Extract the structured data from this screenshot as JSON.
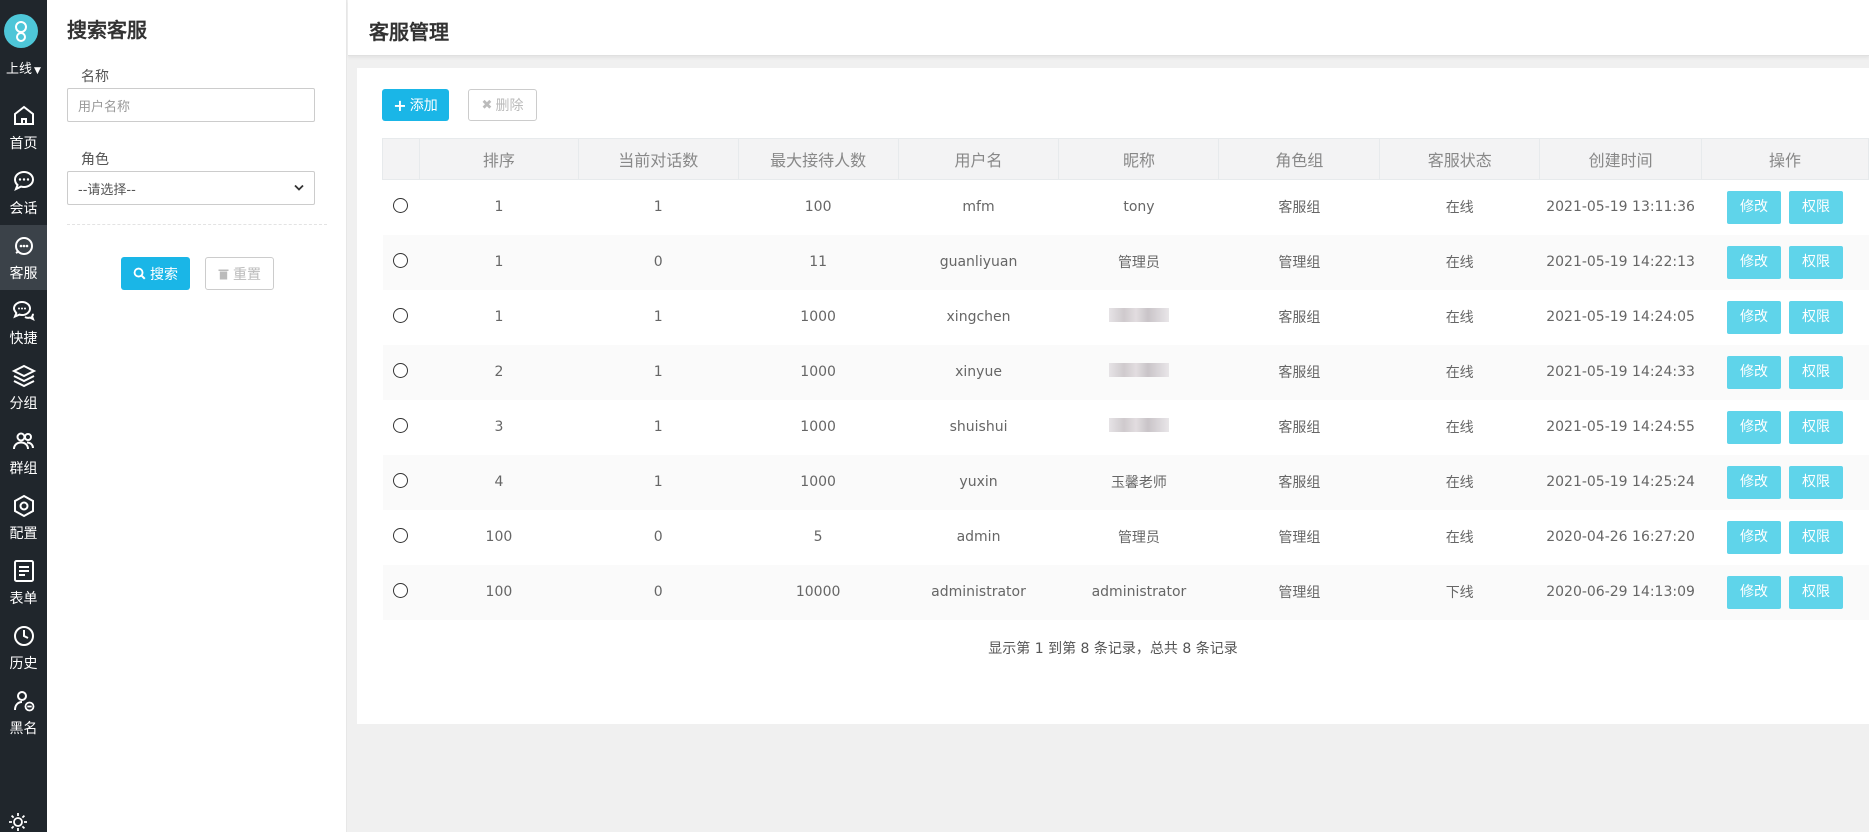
{
  "rail": {
    "status_label": "上线",
    "nav": [
      {
        "label": "首页",
        "icon": "home-icon"
      },
      {
        "label": "会话",
        "icon": "chat-icon"
      },
      {
        "label": "客服",
        "icon": "service-icon"
      },
      {
        "label": "快捷",
        "icon": "quick-reply-icon"
      },
      {
        "label": "分组",
        "icon": "layers-icon"
      },
      {
        "label": "群组",
        "icon": "group-icon"
      },
      {
        "label": "配置",
        "icon": "hexagon-gear-icon"
      },
      {
        "label": "表单",
        "icon": "form-icon"
      },
      {
        "label": "历史",
        "icon": "clock-icon"
      },
      {
        "label": "黑名",
        "icon": "blacklist-user-icon"
      }
    ],
    "active_index": 2
  },
  "search": {
    "title": "搜索客服",
    "name_label": "名称",
    "name_placeholder": "用户名称",
    "role_label": "角色",
    "role_selected": "--请选择--",
    "search_button": "搜索",
    "reset_button": "重置"
  },
  "header": {
    "title": "客服管理"
  },
  "toolbar": {
    "add_button": "添加",
    "delete_button": "删除"
  },
  "table": {
    "columns": [
      "排序",
      "当前对话数",
      "最大接待人数",
      "用户名",
      "昵称",
      "角色组",
      "客服状态",
      "创建时间",
      "操作"
    ],
    "edit_label": "修改",
    "perm_label": "权限",
    "rows": [
      {
        "sort": "1",
        "current": "1",
        "max": "100",
        "username": "mfm",
        "nickname": "tony",
        "role": "客服组",
        "status": "在线",
        "created": "2021-05-19 13:11:36"
      },
      {
        "sort": "1",
        "current": "0",
        "max": "11",
        "username": "guanliyuan",
        "nickname": "管理员",
        "role": "管理组",
        "status": "在线",
        "created": "2021-05-19 14:22:13"
      },
      {
        "sort": "1",
        "current": "1",
        "max": "1000",
        "username": "xingchen",
        "nickname": "",
        "role": "客服组",
        "status": "在线",
        "created": "2021-05-19 14:24:05"
      },
      {
        "sort": "2",
        "current": "1",
        "max": "1000",
        "username": "xinyue",
        "nickname": "",
        "role": "客服组",
        "status": "在线",
        "created": "2021-05-19 14:24:33"
      },
      {
        "sort": "3",
        "current": "1",
        "max": "1000",
        "username": "shuishui",
        "nickname": "",
        "role": "客服组",
        "status": "在线",
        "created": "2021-05-19 14:24:55"
      },
      {
        "sort": "4",
        "current": "1",
        "max": "1000",
        "username": "yuxin",
        "nickname": "玉馨老师",
        "role": "客服组",
        "status": "在线",
        "created": "2021-05-19 14:25:24"
      },
      {
        "sort": "100",
        "current": "0",
        "max": "5",
        "username": "admin",
        "nickname": "管理员",
        "role": "管理组",
        "status": "在线",
        "created": "2020-04-26 16:27:20"
      },
      {
        "sort": "100",
        "current": "0",
        "max": "10000",
        "username": "administrator",
        "nickname": "administrator",
        "role": "管理组",
        "status": "下线",
        "created": "2020-06-29 14:13:09"
      }
    ]
  },
  "pagination": {
    "summary": "显示第 1 到第 8 条记录，总共 8 条记录"
  },
  "colors": {
    "primary": "#1ab6e7",
    "op_button": "#5fd4ea",
    "rail_bg": "#20262c",
    "rail_active": "#3b4249"
  }
}
